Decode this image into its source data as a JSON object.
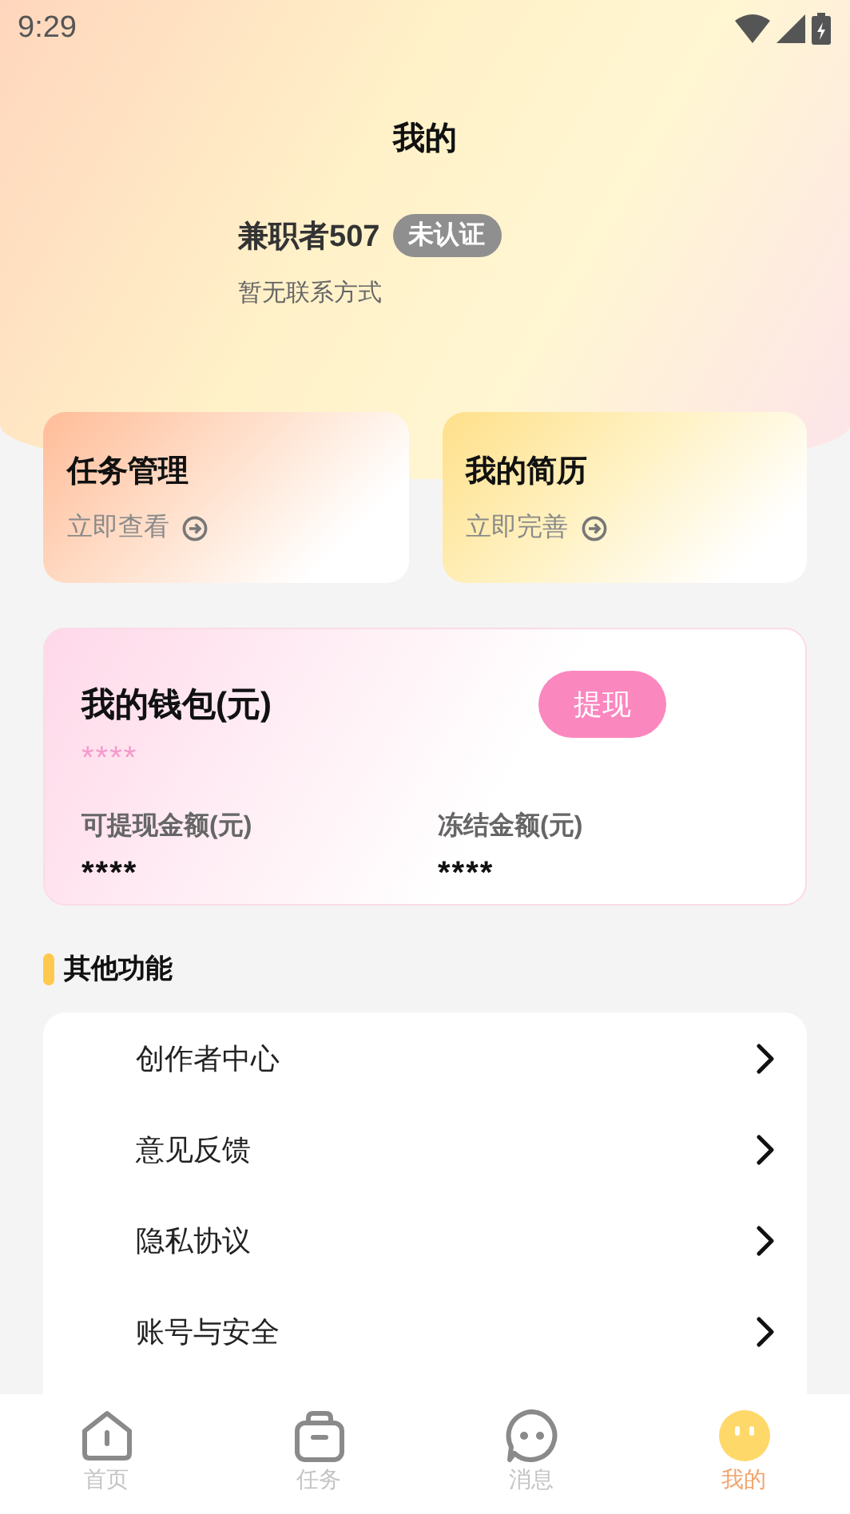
{
  "status_bar": {
    "time": "9:29"
  },
  "header": {
    "title": "我的",
    "username": "兼职者507",
    "badge": "未认证",
    "contact": "暂无联系方式"
  },
  "shortcuts": [
    {
      "kind": "task",
      "title": "任务管理",
      "action": "立即查看"
    },
    {
      "kind": "resume",
      "title": "我的简历",
      "action": "立即完善"
    }
  ],
  "wallet": {
    "title": "我的钱包(元)",
    "balance": "****",
    "withdraw_button": "提现",
    "stats": [
      {
        "label": "可提现金额(元)",
        "value": "****"
      },
      {
        "label": "冻结金额(元)",
        "value": "****"
      }
    ]
  },
  "other": {
    "title": "其他功能",
    "items": [
      "创作者中心",
      "意见反馈",
      "隐私协议",
      "账号与安全"
    ]
  },
  "tabs": [
    {
      "kind": "home",
      "label": "首页",
      "selected": false
    },
    {
      "kind": "task",
      "label": "任务",
      "selected": false
    },
    {
      "kind": "message",
      "label": "消息",
      "selected": false
    },
    {
      "kind": "mine",
      "label": "我的",
      "selected": true
    }
  ]
}
